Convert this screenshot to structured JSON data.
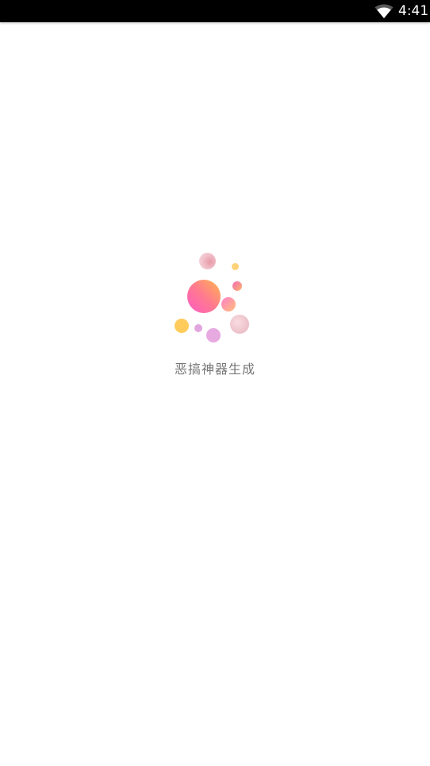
{
  "status_bar": {
    "time": "4:41",
    "wifi_icon": "wifi-icon"
  },
  "splash": {
    "app_name": "恶搞神器生成",
    "logo_icon": "bubbles-logo-icon"
  }
}
